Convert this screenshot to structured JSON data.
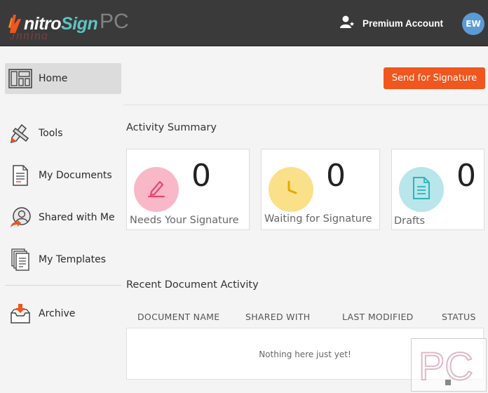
{
  "header": {
    "logo_nitro": "nitro",
    "logo_sign": "Sign",
    "logo_watermark": "PC",
    "logo_watermark_script": "Jnnina",
    "account_label": "Premium Account",
    "avatar_initials": "EW"
  },
  "sidebar": {
    "items": [
      {
        "label": "Home",
        "icon": "home-layout-icon",
        "active": true
      },
      {
        "label": "Tools",
        "icon": "pencil-tools-icon"
      },
      {
        "label": "My Documents",
        "icon": "document-icon"
      },
      {
        "label": "Shared with Me",
        "icon": "shared-user-icon"
      },
      {
        "label": "My Templates",
        "icon": "templates-icon"
      },
      {
        "label": "Archive",
        "icon": "archive-box-icon"
      }
    ]
  },
  "main": {
    "send_button_label": "Send for Signature",
    "activity_title": "Activity Summary",
    "cards": [
      {
        "count": "0",
        "label": "Needs Your Signature",
        "icon": "pen-icon",
        "color": "#f9b8c8"
      },
      {
        "count": "0",
        "label": "Waiting for Signature",
        "icon": "clock-icon",
        "color": "#fbe08a"
      },
      {
        "count": "0",
        "label": "Drafts",
        "icon": "draft-document-icon",
        "color": "#b8e6ea"
      }
    ],
    "recent_title": "Recent Document Activity",
    "table": {
      "headers": [
        "DOCUMENT NAME",
        "SHARED WITH",
        "LAST MODIFIED",
        "STATUS"
      ],
      "empty_message": "Nothing here just yet!"
    }
  },
  "watermark": {
    "text": "PC"
  },
  "colors": {
    "header_bg": "#3a3a3a",
    "accent": "#f0561d",
    "logo_sign": "#5fc3c3",
    "avatar": "#5b9bd5"
  }
}
